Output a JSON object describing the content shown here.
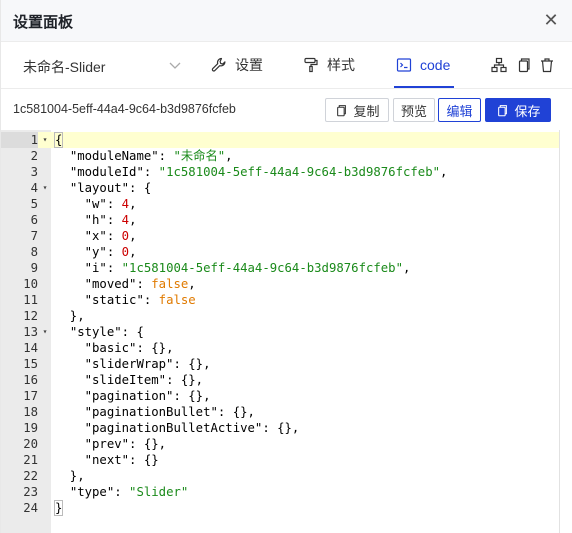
{
  "header": {
    "title": "设置面板",
    "close_icon": "close-icon"
  },
  "toolbar": {
    "module_select": "未命名-Slider",
    "tabs": [
      {
        "label": "设置",
        "icon": "wrench-icon"
      },
      {
        "label": "样式",
        "icon": "paint-roller-icon"
      },
      {
        "label": "code",
        "icon": "terminal-icon"
      }
    ],
    "active_tab": "code",
    "actions": [
      "hierarchy-icon",
      "copy-icon",
      "delete-icon"
    ]
  },
  "idrow": {
    "uuid": "1c581004-5eff-44a4-9c64-b3d9876fcfeb",
    "copy_label": "复制",
    "preview_label": "预览",
    "edit_label": "编辑",
    "save_label": "保存"
  },
  "editor": {
    "active_line": 1,
    "lines": [
      {
        "n": "1",
        "fold": true,
        "t": "{"
      },
      {
        "n": "2",
        "t": "  \"moduleName\": \"未命名\","
      },
      {
        "n": "3",
        "t": "  \"moduleId\": \"1c581004-5eff-44a4-9c64-b3d9876fcfeb\","
      },
      {
        "n": "4",
        "fold": true,
        "t": "  \"layout\": {"
      },
      {
        "n": "5",
        "t": "    \"w\": 4,"
      },
      {
        "n": "6",
        "t": "    \"h\": 4,"
      },
      {
        "n": "7",
        "t": "    \"x\": 0,"
      },
      {
        "n": "8",
        "t": "    \"y\": 0,"
      },
      {
        "n": "9",
        "t": "    \"i\": \"1c581004-5eff-44a4-9c64-b3d9876fcfeb\","
      },
      {
        "n": "10",
        "t": "    \"moved\": false,"
      },
      {
        "n": "11",
        "t": "    \"static\": false"
      },
      {
        "n": "12",
        "t": "  },"
      },
      {
        "n": "13",
        "fold": true,
        "t": "  \"style\": {"
      },
      {
        "n": "14",
        "t": "    \"basic\": {},"
      },
      {
        "n": "15",
        "t": "    \"sliderWrap\": {},"
      },
      {
        "n": "16",
        "t": "    \"slideItem\": {},"
      },
      {
        "n": "17",
        "t": "    \"pagination\": {},"
      },
      {
        "n": "18",
        "t": "    \"paginationBullet\": {},"
      },
      {
        "n": "19",
        "t": "    \"paginationBulletActive\": {},"
      },
      {
        "n": "20",
        "t": "    \"prev\": {},"
      },
      {
        "n": "21",
        "t": "    \"next\": {}"
      },
      {
        "n": "22",
        "t": "  },"
      },
      {
        "n": "23",
        "t": "  \"type\": \"Slider\""
      },
      {
        "n": "24",
        "t": "}"
      }
    ]
  },
  "colors": {
    "accent": "#2042d6",
    "string": "#1a8a1a",
    "number": "#cc0000",
    "boolean": "#e07a00"
  }
}
